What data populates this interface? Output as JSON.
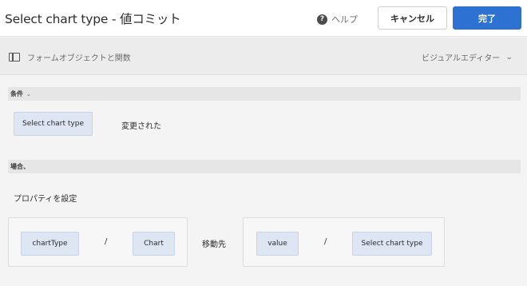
{
  "header": {
    "title": "Select chart type - 値コミット",
    "help_label": "ヘルプ",
    "help_icon": "help-circle-icon",
    "cancel_label": "キャンセル",
    "done_label": "完了"
  },
  "subbar": {
    "left_label": "フォームオブジェクトと関数",
    "left_icon": "panel-toggle-icon",
    "right_label": "ビジュアルエディター",
    "right_icon": "chevron-down-icon"
  },
  "condition": {
    "section_label": "条件",
    "field_token": "Select chart type",
    "operator_text": "変更された"
  },
  "when": {
    "section_label": "場合、",
    "action_text": "プロパティを設定",
    "left_group": {
      "property_token": "chartType",
      "separator": "/",
      "object_token": "Chart"
    },
    "to_label": "移動先",
    "right_group": {
      "property_token": "value",
      "separator": "/",
      "object_token": "Select chart type"
    }
  },
  "colors": {
    "primary_button": "#2d72d2",
    "token_background": "#dde6f2"
  }
}
